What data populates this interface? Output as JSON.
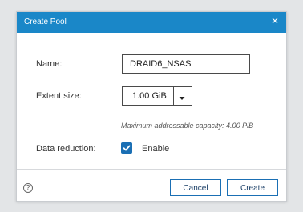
{
  "dialog": {
    "title": "Create Pool",
    "close_symbol": "×"
  },
  "form": {
    "name_label": "Name:",
    "name_value": "DRAID6_NSAS",
    "extent_label": "Extent size:",
    "extent_value": "1.00 GiB",
    "capacity_hint": "Maximum addressable capacity: 4.00 PiB",
    "reduction_label": "Data reduction:",
    "reduction_checked": true,
    "reduction_option": "Enable"
  },
  "footer": {
    "help_symbol": "?",
    "cancel_label": "Cancel",
    "create_label": "Create"
  },
  "colors": {
    "titlebar": "#1a87c8",
    "checkbox": "#1a6fb4",
    "button_border": "#1a6fb4",
    "backdrop": "#e3e5e7"
  }
}
